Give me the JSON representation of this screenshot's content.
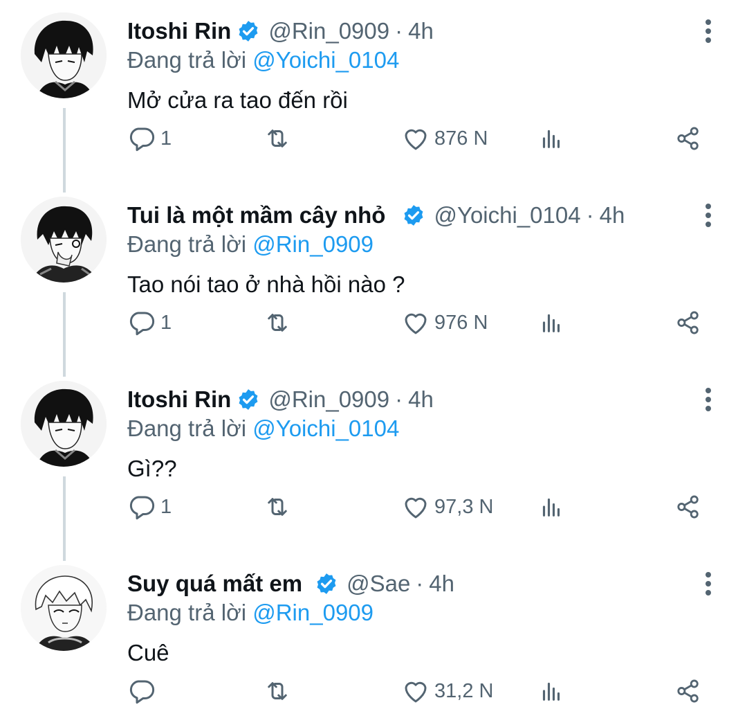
{
  "tweets": [
    {
      "name": "Itoshi Rin",
      "handle": "@Rin_0909",
      "dot": "·",
      "time": "4h",
      "replying_prefix": "Đang trả lời",
      "replying_to": "@Yoichi_0104",
      "text": "Mở cửa ra tao đến rồi",
      "replies": "1",
      "likes": "876 N",
      "avatar": "avatar-rin"
    },
    {
      "name": "Tui là một mầm cây nhỏ",
      "handle": "@Yoichi_0104",
      "dot": "·",
      "time": "4h",
      "replying_prefix": "Đang trả lời",
      "replying_to": "@Rin_0909",
      "text": "Tao nói tao ở nhà hồi nào ?",
      "replies": "1",
      "likes": "976 N",
      "avatar": "avatar-yoichi"
    },
    {
      "name": "Itoshi Rin",
      "handle": "@Rin_0909",
      "dot": "·",
      "time": "4h",
      "replying_prefix": "Đang trả lời",
      "replying_to": "@Yoichi_0104",
      "text": "Gì??",
      "replies": "1",
      "likes": "97,3 N",
      "avatar": "avatar-rin"
    },
    {
      "name": "Suy quá mất em",
      "handle": "@Sae",
      "dot": "·",
      "time": "4h",
      "replying_prefix": "Đang trả lời",
      "replying_to": "@Rin_0909",
      "text": "Cuê",
      "replies": "",
      "likes": "31,2 N",
      "avatar": "avatar-sae"
    }
  ],
  "icons": {
    "verified": "verified-badge-icon",
    "more": "more-vertical-icon",
    "reply": "reply-icon",
    "retweet": "retweet-icon",
    "like": "heart-icon",
    "views": "views-icon",
    "share": "share-icon"
  },
  "colors": {
    "accent": "#1d9bf0",
    "secondary_text": "#536471",
    "primary_text": "#0f1419",
    "thread_line": "#cfd9de"
  }
}
